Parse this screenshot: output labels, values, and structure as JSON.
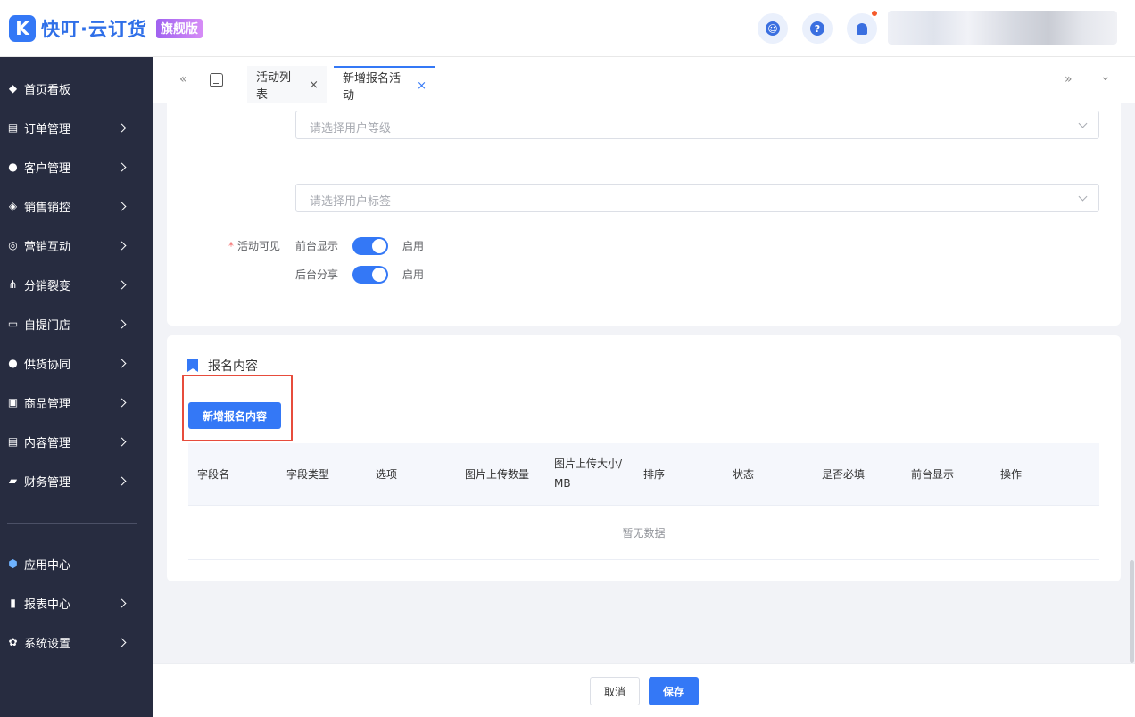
{
  "header": {
    "logo_mark": "K",
    "app_name": "快叮·云订货",
    "edition_badge": "旗舰版",
    "help_glyph": "?",
    "service_glyph": "☺"
  },
  "sidebar": {
    "items": [
      {
        "label": "首页看板",
        "icon": "dashboard-icon",
        "glyph": "◆",
        "has_arrow": false
      },
      {
        "label": "订单管理",
        "icon": "order-icon",
        "glyph": "▤",
        "has_arrow": true
      },
      {
        "label": "客户管理",
        "icon": "customer-icon",
        "glyph": "●",
        "has_arrow": true
      },
      {
        "label": "销售销控",
        "icon": "sales-tag-icon",
        "glyph": "◈",
        "has_arrow": true
      },
      {
        "label": "营销互动",
        "icon": "target-icon",
        "glyph": "◎",
        "has_arrow": true
      },
      {
        "label": "分销裂变",
        "icon": "hierarchy-icon",
        "glyph": "⋔",
        "has_arrow": true
      },
      {
        "label": "自提门店",
        "icon": "store-icon",
        "glyph": "▭",
        "has_arrow": true
      },
      {
        "label": "供货协同",
        "icon": "supplier-icon",
        "glyph": "●",
        "has_arrow": true
      },
      {
        "label": "商品管理",
        "icon": "goods-bag-icon",
        "glyph": "▣",
        "has_arrow": true
      },
      {
        "label": "内容管理",
        "icon": "content-doc-icon",
        "glyph": "▤",
        "has_arrow": true
      },
      {
        "label": "财务管理",
        "icon": "finance-icon",
        "glyph": "▰",
        "has_arrow": true
      }
    ],
    "bottom_items": [
      {
        "label": "应用中心",
        "icon": "app-cube-icon",
        "glyph": "⬢",
        "has_arrow": false
      },
      {
        "label": "报表中心",
        "icon": "bar-chart-icon",
        "glyph": "▮",
        "has_arrow": true
      },
      {
        "label": "系统设置",
        "icon": "gear-icon",
        "glyph": "✿",
        "has_arrow": true
      }
    ]
  },
  "tabs": {
    "prev_glyph": "«",
    "next_glyph": "»",
    "dropdown_glyph": "⌄",
    "items": [
      {
        "label": "活动列表",
        "close": "×"
      },
      {
        "label": "新增报名活动",
        "close": "×"
      }
    ]
  },
  "form": {
    "user_level_placeholder": "请选择用户等级",
    "user_tag_placeholder": "请选择用户标签",
    "visible_label": "活动可见",
    "required_mark": "*",
    "front_display_label": "前台显示",
    "front_display_state": "启用",
    "back_share_label": "后台分享",
    "back_share_state": "启用"
  },
  "signup": {
    "section_title": "报名内容",
    "add_button": "新增报名内容",
    "columns": [
      "字段名",
      "字段类型",
      "选项",
      "图片上传数量",
      "图片上传大小/ MB",
      "排序",
      "状态",
      "是否必填",
      "前台显示",
      "操作"
    ],
    "empty_text": "暂无数据"
  },
  "footer": {
    "cancel": "取消",
    "save": "保存"
  },
  "colors": {
    "primary": "#3478f6",
    "sidebar_bg": "#272c40",
    "highlight_border": "#e74c3c"
  }
}
